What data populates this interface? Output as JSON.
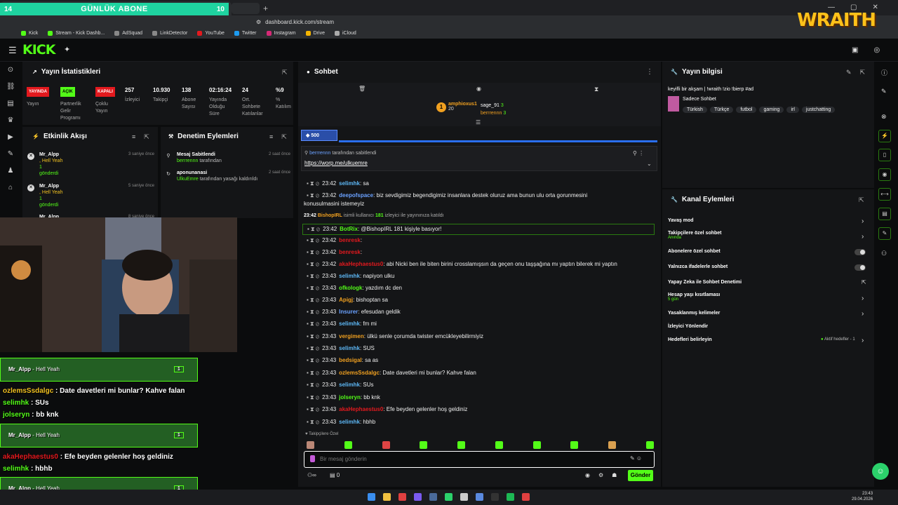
{
  "browser": {
    "url": "dashboard.kick.com/stream",
    "bookmarks": [
      "Kick",
      "Stream - Kick Dashb...",
      "AdSquad",
      "LinkDetector",
      "YouTube",
      "Twitter",
      "Instagram",
      "Drive",
      "iCloud"
    ]
  },
  "overlay": {
    "abone_left": "14",
    "abone_title": "GÜNLÜK ABONE",
    "abone_right": "10",
    "logo": "WRAITH"
  },
  "stats": {
    "title": "Yayın İstatistikleri",
    "items": [
      {
        "value": "YAYINDA",
        "label": "Yayın"
      },
      {
        "value": "AÇIK",
        "label": "Partnerlik Gelir Programı"
      },
      {
        "value": "KAPALI",
        "label": "Çoklu Yayın"
      },
      {
        "value": "257",
        "label": "İzleyici"
      },
      {
        "value": "10.930",
        "label": "Takipçi"
      },
      {
        "value": "138",
        "label": "Abone Sayısı"
      },
      {
        "value": "02:16:24",
        "label": "Yayında Olduğu Süre"
      },
      {
        "value": "24",
        "label": "Ort. Sohbete Katılanlar"
      },
      {
        "value": "%9",
        "label": "% Katılım"
      }
    ]
  },
  "activity": {
    "title": "Etkinlik Akışı",
    "events": [
      {
        "user": "Mr_Alpp",
        "msg": ", Hell Yeah",
        "count": "1",
        "action": "gönderdi",
        "ago": "3 saniye önce"
      },
      {
        "user": "Mr_Alpp",
        "msg": ", Hell Yeah",
        "count": "1",
        "action": "gönderdi",
        "ago": "5 saniye önce"
      },
      {
        "user": "Mr_Alpp",
        "msg": "",
        "count": "",
        "action": "",
        "ago": "8 saniye önce"
      }
    ]
  },
  "moderation": {
    "title": "Denetim Eylemleri",
    "items": [
      {
        "title": "Mesaj Sabitlendi",
        "by": "berrrennn",
        "suffix": "tarafından",
        "ago": "2 saat önce"
      },
      {
        "title": "aponunanasi",
        "by": "UlkuEmre",
        "suffix": "tarafından yasağı kaldırıldı",
        "ago": "2 saat önce"
      }
    ]
  },
  "chat": {
    "title": "Sohbet",
    "top_gifter": {
      "name": "amphioxus1",
      "count": "20"
    },
    "gifters": [
      {
        "name": "sage_91",
        "count": "3"
      },
      {
        "name": "berrrennn",
        "count": "3"
      }
    ],
    "kicks": "500",
    "pinned": {
      "by": "berrrennn",
      "text": "tarafından sabitlendi",
      "link": "https://worp.me/ulkuemre"
    },
    "join_notice": {
      "time": "23:42",
      "user": "BishopIRL",
      "pre": "isimli kullanıcı",
      "count": "181",
      "post": "izleyici ile yayınınıza katıldı"
    },
    "messages": [
      {
        "time": "23:42",
        "user": "selimhk",
        "color": "#5db7f5",
        "text": "sa"
      },
      {
        "time": "23:42",
        "user": "deepofspace",
        "color": "#6aa1ff",
        "text": "biz sevdigimiz begendigimiz insanlara destek oluruz ama bunun ulu orta gorunmesini"
      },
      {
        "time": "",
        "user": "",
        "color": "#eee",
        "text": "konusulmasini istemeyiz"
      },
      {
        "time": "23:42",
        "user": "BotRix",
        "color": "#53fc18",
        "text": "@BishopIRL 181 kişiyle basıyor!"
      },
      {
        "time": "23:42",
        "user": "benresk",
        "color": "#e3191e",
        "text": ""
      },
      {
        "time": "23:42",
        "user": "benresk",
        "color": "#e3191e",
        "text": ""
      },
      {
        "time": "23:42",
        "user": "akaHephaestus0",
        "color": "#e3191e",
        "text": "abi Nicki ben ile biten birini crosslamışsın da geçen onu taşşağına mı yaptın bilerek mi yaptın"
      },
      {
        "time": "23:43",
        "user": "selimhk",
        "color": "#5db7f5",
        "text": "napiyon ulku"
      },
      {
        "time": "23:43",
        "user": "ofkologk",
        "color": "#53fc18",
        "text": "yazdım dc den"
      },
      {
        "time": "23:43",
        "user": "Apigj",
        "color": "#f0a020",
        "text": "bishoptan sa"
      },
      {
        "time": "23:43",
        "user": "Insurer",
        "color": "#6aa1ff",
        "text": "efesudan geldik"
      },
      {
        "time": "23:43",
        "user": "selimhk",
        "color": "#5db7f5",
        "text": "fm mi"
      },
      {
        "time": "23:43",
        "user": "vergimen",
        "color": "#f0a020",
        "text": "ülkü senle çorumda twister emcükleyebilirmiyiz"
      },
      {
        "time": "23:43",
        "user": "selimhk",
        "color": "#5db7f5",
        "text": "SUS"
      },
      {
        "time": "23:43",
        "user": "bedsigal",
        "color": "#f0a020",
        "text": "sa as"
      },
      {
        "time": "23:43",
        "user": "ozlemsSsdalgc",
        "color": "#f0a020",
        "text": "Date davetleri mi bunlar? Kahve falan"
      },
      {
        "time": "23:43",
        "user": "selimhk",
        "color": "#5db7f5",
        "text": "SUs"
      },
      {
        "time": "23:43",
        "user": "jolseryn",
        "color": "#53fc18",
        "text": "bb knk"
      },
      {
        "time": "23:43",
        "user": "akaHephaestus0",
        "color": "#e3191e",
        "text": "Efe beyden gelenler hoş geldiniz"
      },
      {
        "time": "23:43",
        "user": "selimhk",
        "color": "#5db7f5",
        "text": "hbhb"
      }
    ],
    "followers_only": "Takipçilere Özel",
    "input_placeholder": "Bir mesaj gönderin",
    "counter": "0",
    "send_label": "Gönder"
  },
  "stream_info": {
    "title": "Yayın bilgisi",
    "stream_title": "keyifli bir akşam | !wraith !zio !bierp #ad",
    "category": "Sadece Sohbet",
    "tags": [
      "Türkish",
      "Türkçe",
      "futbol",
      "gaming",
      "irl",
      "justchatting"
    ]
  },
  "channel_actions": {
    "title": "Kanal Eylemleri",
    "items": [
      {
        "label": "Yavaş mod",
        "sub": ""
      },
      {
        "label": "Takipçilere özel sohbet",
        "sub": "Anında"
      },
      {
        "label": "Abonelere özel sohbet",
        "sub": ""
      },
      {
        "label": "Yalnızca ifadelerle sohbet",
        "sub": ""
      },
      {
        "label": "Yapay Zeka ile Sohbet Denetimi",
        "sub": ""
      },
      {
        "label": "Hesap yaşı kısıtlaması",
        "sub": "5 gün"
      },
      {
        "label": "Yasaklanmış kelimeler",
        "sub": ""
      },
      {
        "label": "İzleyici Yönlendir",
        "sub": ""
      },
      {
        "label": "Hedefleri belirleyin",
        "sub": ""
      }
    ],
    "goals_status": "Aktif hedefler - 1"
  },
  "overlay_chat": [
    {
      "user": "Mr_Alpp",
      "text": "- Hell Yeah",
      "count": "1"
    },
    {
      "user": "ozlemsSsdalgc",
      "text": ": Date davetleri mi bunlar? Kahve falan"
    },
    {
      "user": "selimhk",
      "text": ": SUs"
    },
    {
      "user": "jolseryn",
      "text": ": bb knk"
    },
    {
      "user": "Mr_Alpp",
      "text": "- Hell Yeah",
      "count": "1"
    },
    {
      "user": "akaHephaestus0",
      "text": ": Efe beyden gelenler hoş geldiniz"
    },
    {
      "user": "selimhk",
      "text": ": hbhb"
    },
    {
      "user": "Mr_Alpp",
      "text": "- Hell Yeah",
      "count": "1"
    }
  ],
  "taskbar": {
    "time": "23:43",
    "date": "29.04.2026"
  }
}
